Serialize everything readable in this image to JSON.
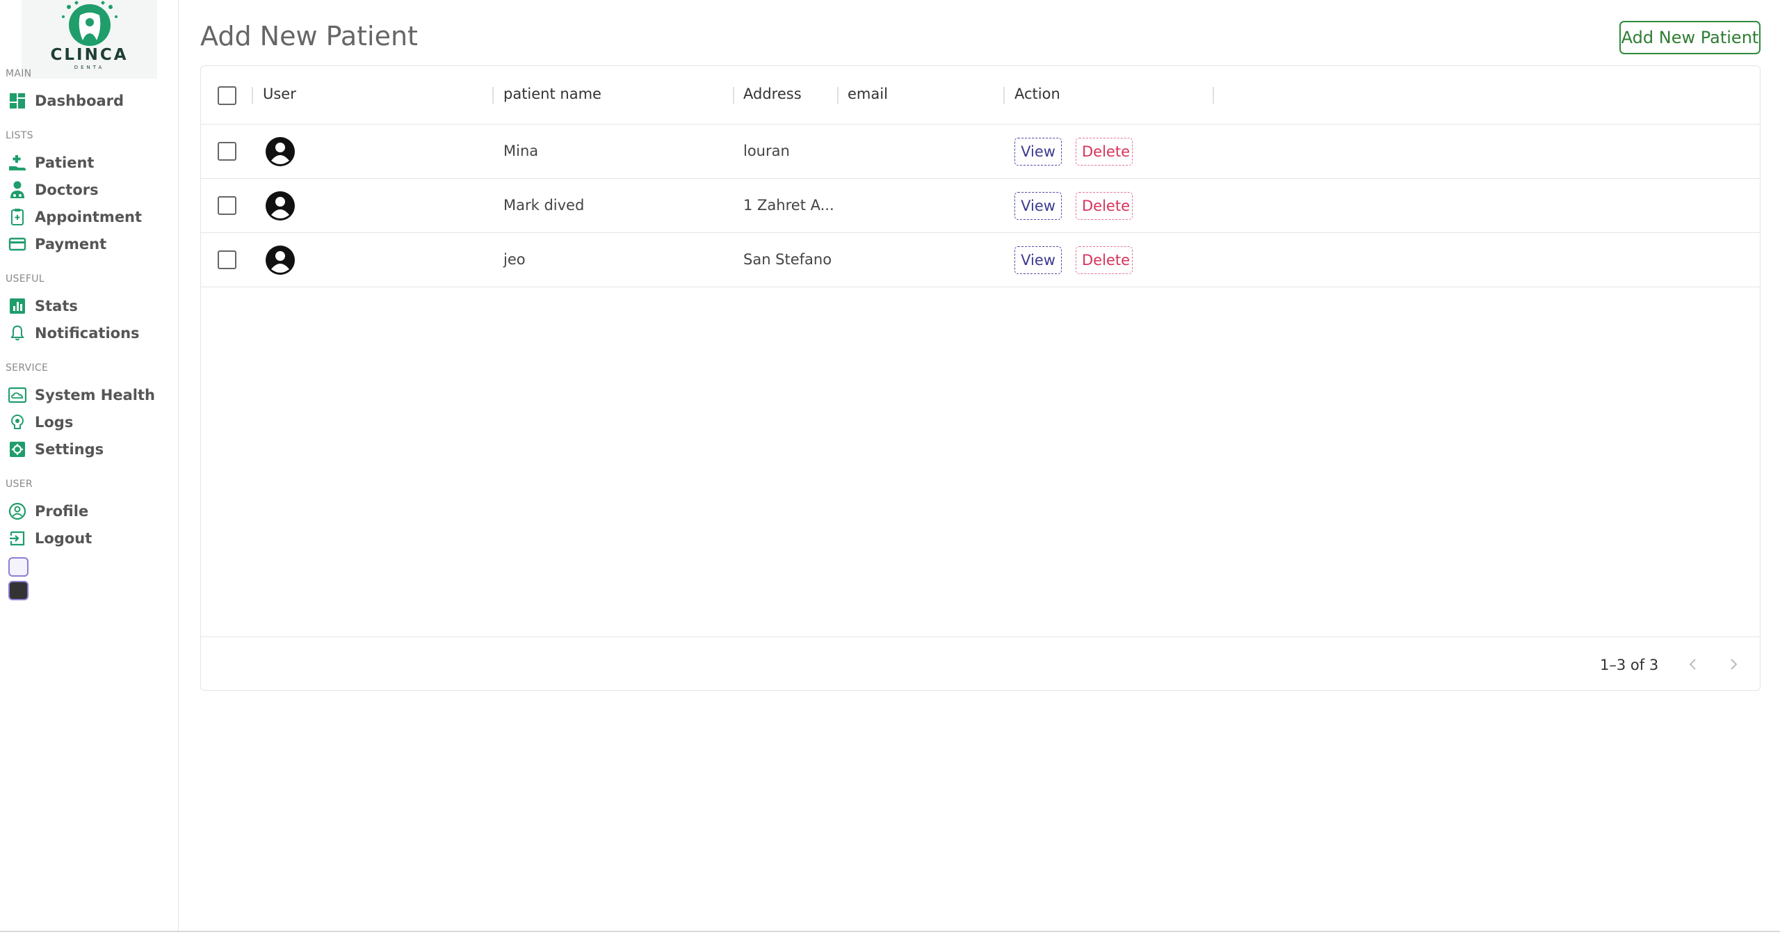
{
  "brand": {
    "name": "CLINCA",
    "sub": "DENTA",
    "accent": "#1f9d6b"
  },
  "sidebar": {
    "sections": [
      {
        "title": "MAIN",
        "items": [
          {
            "label": "Dashboard",
            "icon": "dashboard-icon"
          }
        ]
      },
      {
        "title": "LISTS",
        "items": [
          {
            "label": "Patient",
            "icon": "patient-icon"
          },
          {
            "label": "Doctors",
            "icon": "doctor-icon"
          },
          {
            "label": "Appointment",
            "icon": "clipboard-icon"
          },
          {
            "label": "Payment",
            "icon": "credit-card-icon"
          }
        ]
      },
      {
        "title": "USEFUL",
        "items": [
          {
            "label": "Stats",
            "icon": "bar-chart-icon"
          },
          {
            "label": "Notifications",
            "icon": "bell-icon"
          }
        ]
      },
      {
        "title": "SERVICE",
        "items": [
          {
            "label": "System Health",
            "icon": "cloud-health-icon"
          },
          {
            "label": "Logs",
            "icon": "brain-icon"
          },
          {
            "label": "Settings",
            "icon": "settings-icon"
          }
        ]
      },
      {
        "title": "USER",
        "items": [
          {
            "label": "Profile",
            "icon": "profile-icon"
          },
          {
            "label": "Logout",
            "icon": "logout-icon"
          }
        ]
      }
    ],
    "theme_swatches": [
      {
        "name": "light",
        "color": "#f4f2fb"
      },
      {
        "name": "dark",
        "color": "#333333"
      }
    ]
  },
  "header": {
    "title": "Add New Patient",
    "add_button_label": "Add New Patient"
  },
  "table": {
    "columns": [
      "User",
      "patient name",
      "Address",
      "email",
      "Action"
    ],
    "rows": [
      {
        "name": "Mina",
        "address": "louran",
        "email": ""
      },
      {
        "name": "Mark dived",
        "address": "1 Zahret A...",
        "email": ""
      },
      {
        "name": "jeo",
        "address": "San Stefano",
        "email": ""
      }
    ],
    "action_labels": {
      "view": "View",
      "delete": "Delete"
    }
  },
  "pagination": {
    "text": "1–3 of 3"
  }
}
